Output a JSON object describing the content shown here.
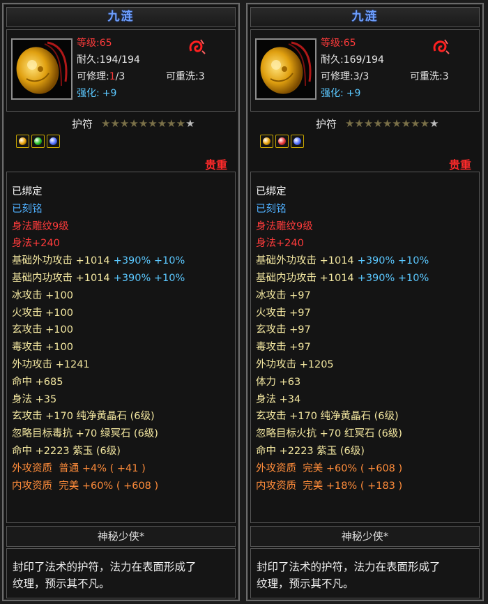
{
  "colors": {
    "title": "#6fa0ff",
    "level": "#ff3b3b",
    "normal": "#e8e8e8",
    "enhance": "#5bc8ff",
    "bind": "#ffffff",
    "engraved": "#4fb0ff",
    "bonus_red": "#ff3b3b",
    "stat": "#f3e7a0",
    "percent": "#5bc8ff",
    "quality": "#ff8c3a",
    "rarity": "#ff2a2a"
  },
  "panels": [
    {
      "title": "九涟",
      "level_label": "等级",
      "level_value": ":65",
      "durability": "耐久:194/194",
      "repair_label": "可修理:",
      "repair_cur": "1",
      "repair_max": "/3",
      "rewash": "可重洗:3",
      "enhance_label": "强化:",
      "enhance_value": "+9",
      "item_type": "护符",
      "stars_total": 9,
      "stars_filled": 8,
      "gems": [
        "#e8a000",
        "#1fc21f",
        "#4b6bff"
      ],
      "rarity": "贵重",
      "bound": "已绑定",
      "engraved": "已刻铭",
      "special_lines": [
        "身法雕纹9级",
        "身法+240"
      ],
      "stats": [
        {
          "text": "基础外功攻击 +1014",
          "extra": "+390% +10%"
        },
        {
          "text": "基础内功攻击 +1014",
          "extra": "+390% +10%"
        },
        {
          "text": "冰攻击 +100",
          "extra": ""
        },
        {
          "text": "火攻击 +100",
          "extra": ""
        },
        {
          "text": "玄攻击 +100",
          "extra": ""
        },
        {
          "text": "毒攻击 +100",
          "extra": ""
        },
        {
          "text": "外功攻击 +1241",
          "extra": ""
        },
        {
          "text": "命中 +685",
          "extra": ""
        },
        {
          "text": "身法 +35",
          "extra": ""
        },
        {
          "text": "玄攻击 +170 纯净黄晶石 (6级)",
          "extra": ""
        },
        {
          "text": "忽略目标毒抗 +70 绿冥石 (6级)",
          "extra": ""
        },
        {
          "text": "命中 +2223 紫玉 (6级)",
          "extra": ""
        }
      ],
      "qualities": [
        "外攻资质  普通 +4% ( +41 )",
        "内攻资质  完美 +60% ( +608 )"
      ],
      "owner": "神秘少侠*",
      "desc_line1": "封印了法术的护符，法力在表面形成了",
      "desc_line2": "纹理，预示其不凡。"
    },
    {
      "title": "九涟",
      "level_label": "等级",
      "level_value": ":65",
      "durability": "耐久:169/194",
      "repair_label": "可修理:",
      "repair_cur": "3",
      "repair_max": "/3",
      "rewash": "可重洗:3",
      "enhance_label": "强化:",
      "enhance_value": "+9",
      "item_type": "护符",
      "stars_total": 9,
      "stars_filled": 8,
      "gems": [
        "#e8a000",
        "#e83030",
        "#4b6bff"
      ],
      "rarity": "贵重",
      "bound": "已绑定",
      "engraved": "已刻铭",
      "special_lines": [
        "身法雕纹9级",
        "身法+240"
      ],
      "stats": [
        {
          "text": "基础外功攻击 +1014",
          "extra": "+390% +10%"
        },
        {
          "text": "基础内功攻击 +1014",
          "extra": "+390% +10%"
        },
        {
          "text": "冰攻击 +97",
          "extra": ""
        },
        {
          "text": "火攻击 +97",
          "extra": ""
        },
        {
          "text": "玄攻击 +97",
          "extra": ""
        },
        {
          "text": "毒攻击 +97",
          "extra": ""
        },
        {
          "text": "外功攻击 +1205",
          "extra": ""
        },
        {
          "text": "体力 +63",
          "extra": ""
        },
        {
          "text": "身法 +34",
          "extra": ""
        },
        {
          "text": "玄攻击 +170 纯净黄晶石 (6级)",
          "extra": ""
        },
        {
          "text": "忽略目标火抗 +70 红冥石 (6级)",
          "extra": ""
        },
        {
          "text": "命中 +2223 紫玉 (6级)",
          "extra": ""
        }
      ],
      "qualities": [
        "外攻资质  完美 +60% ( +608 )",
        "内攻资质  完美 +18% ( +183 )"
      ],
      "owner": "神秘少侠*",
      "desc_line1": "封印了法术的护符，法力在表面形成了",
      "desc_line2": "纹理，预示其不凡。"
    }
  ]
}
